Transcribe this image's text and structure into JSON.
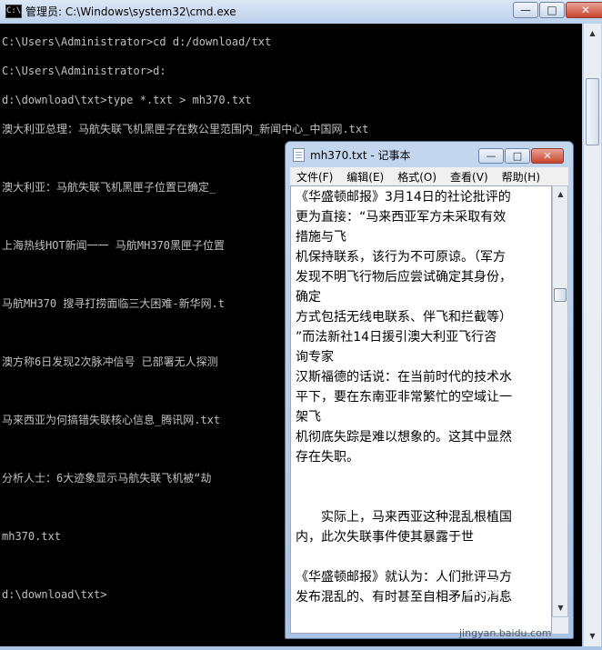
{
  "cmd": {
    "title": "管理员: C:\\Windows\\system32\\cmd.exe",
    "icon_label": "C:\\",
    "lines": [
      "C:\\Users\\Administrator>cd d:/download/txt",
      "",
      "C:\\Users\\Administrator>d:",
      "",
      "d:\\download\\txt>type *.txt > mh370.txt",
      "",
      "澳大利亚总理：马航失联飞机黑匣子在数公里范围内_新闻中心_中国网.txt",
      "",
      "",
      "",
      "澳大利亚：马航失联飞机黑匣子位置已确定_",
      "",
      "",
      "",
      "上海热线HOT新闻一一 马航MH370黑匣子位置",
      "",
      "",
      "",
      "马航MH370 搜寻打捞面临三大困难-新华网.t",
      "",
      "",
      "",
      "澳方称6日发现2次脉冲信号 已部署无人探测",
      "",
      "",
      "",
      "马来西亚为何搞错失联核心信息_腾讯网.txt",
      "",
      "",
      "",
      "分析人士：6大迹象显示马航失联飞机被“劫",
      "",
      "",
      "",
      "mh370.txt",
      "",
      "",
      "",
      "d:\\download\\txt>"
    ]
  },
  "notepad": {
    "title": "mh370.txt - 记事本",
    "menu": [
      "文件(F)",
      "编辑(E)",
      "格式(O)",
      "查看(V)",
      "帮助(H)"
    ],
    "lines": [
      "《华盛顿邮报》3月14日的社论批评的",
      "更为直接：“马来西亚军方未采取有效",
      "措施与飞",
      "机保持联系，该行为不可原谅。（军方",
      "发现不明飞行物后应尝试确定其身份，",
      "确定",
      "方式包括无线电联系、伴飞和拦截等）",
      "”而法新社14日援引澳大利亚飞行咨",
      "询专家",
      "汉斯福德的话说：在当前时代的技术水",
      "平下，要在东南亚非常繁忙的空域让一",
      "架飞",
      "机彻底失踪是难以想象的。这其中显然",
      "存在失职。",
      "",
      "",
      "　　实际上，马来西亚这种混乱根植国",
      "内，此次失联事件使其暴露于世",
      "",
      "《华盛顿邮报》就认为：人们批评马方",
      "发布混乱的、有时甚至自相矛盾的消息"
    ]
  },
  "window_buttons": {
    "minimize": "—",
    "maximize": "□",
    "close": "✕"
  },
  "scrollbar": {
    "up": "▲",
    "down": "▼"
  },
  "watermark": {
    "brand": "Bai 经验",
    "url": "jingyan.baidu.com"
  }
}
